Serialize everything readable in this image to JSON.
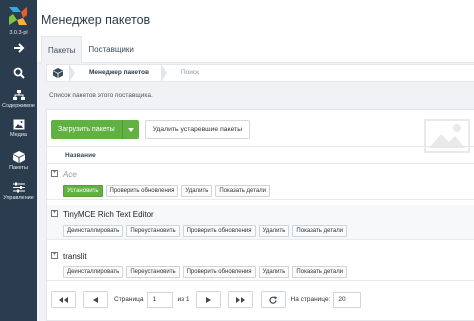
{
  "app": {
    "version": "3.0.3-pl",
    "accent_color": "#61b142",
    "sidebar_color": "#2b3c4e"
  },
  "sidebar": {
    "items": [
      {
        "label": "",
        "icon": "arrow-right-icon"
      },
      {
        "label": "",
        "icon": "search-icon"
      },
      {
        "label": "Содержимое",
        "icon": "sitemap-icon"
      },
      {
        "label": "Медиа",
        "icon": "image-icon"
      },
      {
        "label": "Пакеты",
        "icon": "cube-icon"
      },
      {
        "label": "Управление",
        "icon": "sliders-icon"
      }
    ]
  },
  "header": {
    "title": "Менеджер пакетов",
    "tabs": [
      {
        "label": "Пакеты",
        "active": true
      },
      {
        "label": "Поставщики",
        "active": false
      }
    ]
  },
  "breadcrumb": {
    "items": [
      "Менеджер пакетов",
      "Поиск"
    ]
  },
  "description": "Список пакетов этого поставщика.",
  "toolbar": {
    "download_label": "Загрузить пакеты",
    "remove_outdated_label": "Удалить устаревшие пакеты"
  },
  "table": {
    "column_name": "Название"
  },
  "packages": [
    {
      "name": "Ace",
      "installed": false,
      "actions": [
        "Установить",
        "Проверить обновления",
        "Удалить",
        "Показать детали"
      ]
    },
    {
      "name": "TinyMCE Rich Text Editor",
      "installed": true,
      "actions": [
        "Деинсталлировать",
        "Переустановить",
        "Проверить обновления",
        "Удалить",
        "Показать детали"
      ]
    },
    {
      "name": "translit",
      "installed": true,
      "actions": [
        "Деинсталлировать",
        "Переустановить",
        "Проверить обновления",
        "Удалить",
        "Показать детали"
      ]
    }
  ],
  "pagination": {
    "page_label": "Страница",
    "page_value": "1",
    "of_label": "из 1",
    "per_page_label": "На странице:",
    "per_page_value": "20"
  }
}
